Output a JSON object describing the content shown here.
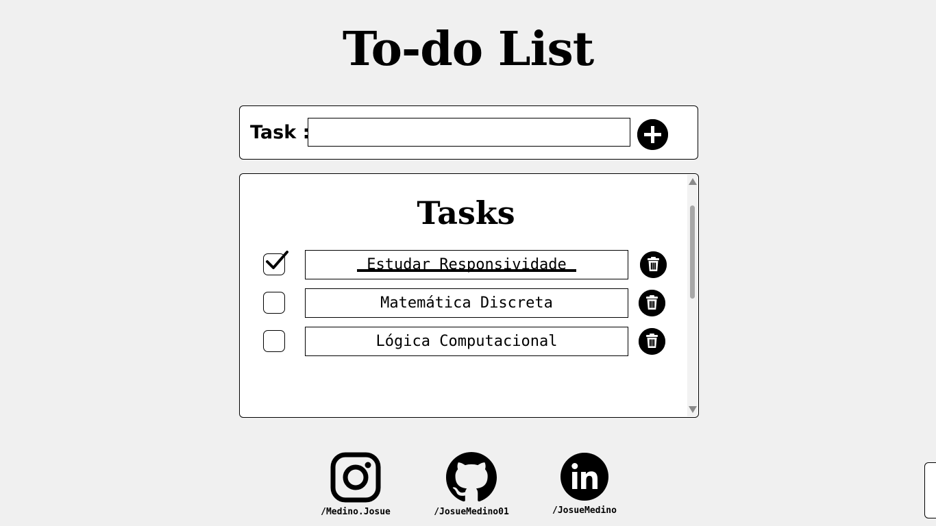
{
  "page": {
    "title": "To-do List"
  },
  "input_section": {
    "label": "Task :",
    "placeholder": "",
    "value": "",
    "add_icon": "plus-circle-icon"
  },
  "tasks_section": {
    "title": "Tasks",
    "items": [
      {
        "text": "Estudar Responsividade",
        "done": true
      },
      {
        "text": "Matemática Discreta",
        "done": false
      },
      {
        "text": "Lógica Computacional",
        "done": false
      }
    ],
    "delete_icon": "trash-icon"
  },
  "footer": {
    "social": [
      {
        "icon": "instagram-icon",
        "handle": "/Medino.Josue"
      },
      {
        "icon": "github-icon",
        "handle": "/JosueMedino01"
      },
      {
        "icon": "linkedin-icon",
        "handle": "/JosueMedino"
      }
    ]
  }
}
